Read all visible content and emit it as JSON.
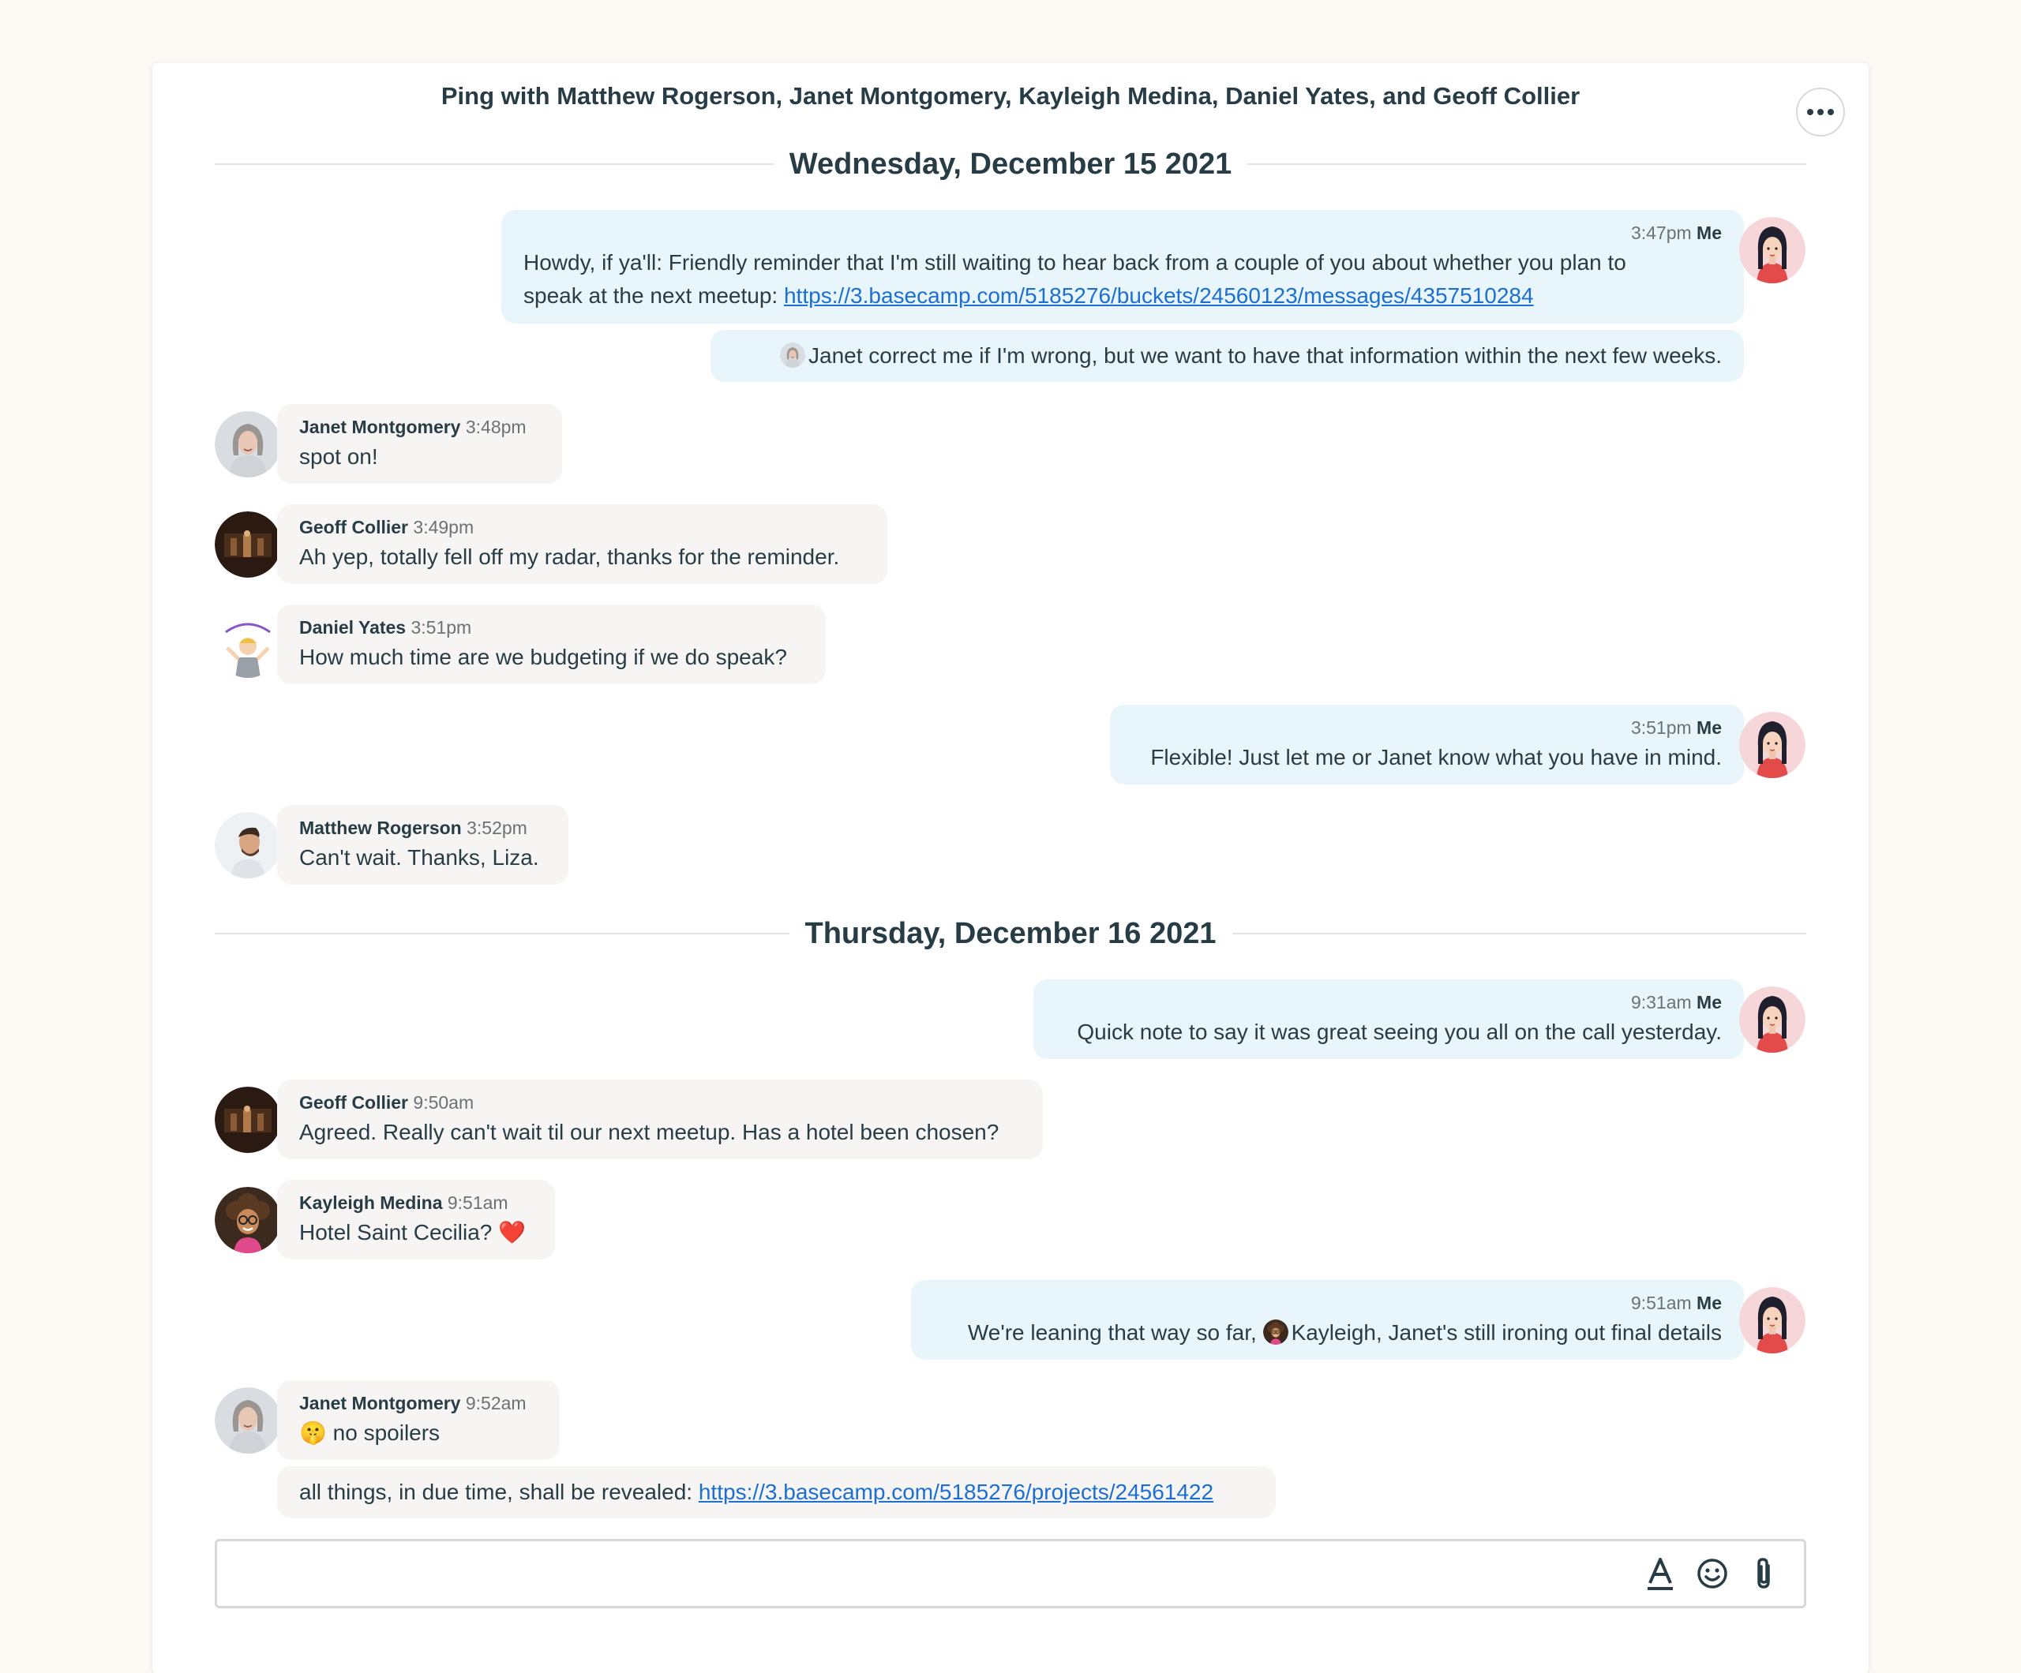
{
  "header": {
    "title": "Ping with Matthew Rogerson, Janet Montgomery, Kayleigh Medina, Daniel Yates, and Geoff Collier",
    "more_icon": "ellipsis-icon"
  },
  "days": [
    {
      "label": "Wednesday, December 15 2021"
    },
    {
      "label": "Thursday, December 16 2021"
    }
  ],
  "messages": [
    {
      "sender": "Me",
      "time": "3:47pm",
      "line1": "Howdy, if ya'll: Friendly reminder that I'm still waiting to hear back from a couple of you about whether you plan to",
      "line2_prefix": "speak at the next meetup: ",
      "link": "https://3.basecamp.com/5185276/buckets/24560123/messages/4357510284"
    },
    {
      "sender": "Me",
      "text": "Janet correct me if I'm wrong, but we want to have that information within the next few weeks."
    },
    {
      "sender": "Janet Montgomery",
      "time": "3:48pm",
      "text": "spot on!"
    },
    {
      "sender": "Geoff Collier",
      "time": "3:49pm",
      "text": "Ah yep, totally fell off my radar, thanks for the reminder."
    },
    {
      "sender": "Daniel Yates",
      "time": "3:51pm",
      "text": "How much time are we budgeting if we do speak?"
    },
    {
      "sender": "Me",
      "time": "3:51pm",
      "text": "Flexible! Just let me or Janet know what you have in mind."
    },
    {
      "sender": "Matthew Rogerson",
      "time": "3:52pm",
      "text": "Can't wait. Thanks, Liza."
    },
    {
      "sender": "Me",
      "time": "9:31am",
      "text": "Quick note to say it was great seeing you all on the call yesterday."
    },
    {
      "sender": "Geoff Collier",
      "time": "9:50am",
      "text": "Agreed. Really can't wait til our next meetup. Has a hotel been chosen?"
    },
    {
      "sender": "Kayleigh Medina",
      "time": "9:51am",
      "text": "Hotel Saint Cecilia? ",
      "emoji": "❤️"
    },
    {
      "sender": "Me",
      "time": "9:51am",
      "text_prefix": "We're leaning that way so far, ",
      "text_suffix": "Kayleigh, Janet's still ironing out final details"
    },
    {
      "sender": "Janet Montgomery",
      "time": "9:52am",
      "emoji": "🤫",
      "text": " no spoilers"
    },
    {
      "sender": "Janet Montgomery",
      "text_prefix": "all things, in due time, shall be revealed: ",
      "link": "https://3.basecamp.com/5185276/projects/24561422"
    }
  ],
  "composer": {
    "placeholder": "",
    "tools": [
      "text-format-icon",
      "emoji-icon",
      "attachment-icon"
    ]
  },
  "colors": {
    "page_bg": "#fdf9f5",
    "my_bubble": "#e8f6fc",
    "their_bubble": "#f6f5f3",
    "link": "#1c6fd1",
    "text": "#283c46"
  }
}
